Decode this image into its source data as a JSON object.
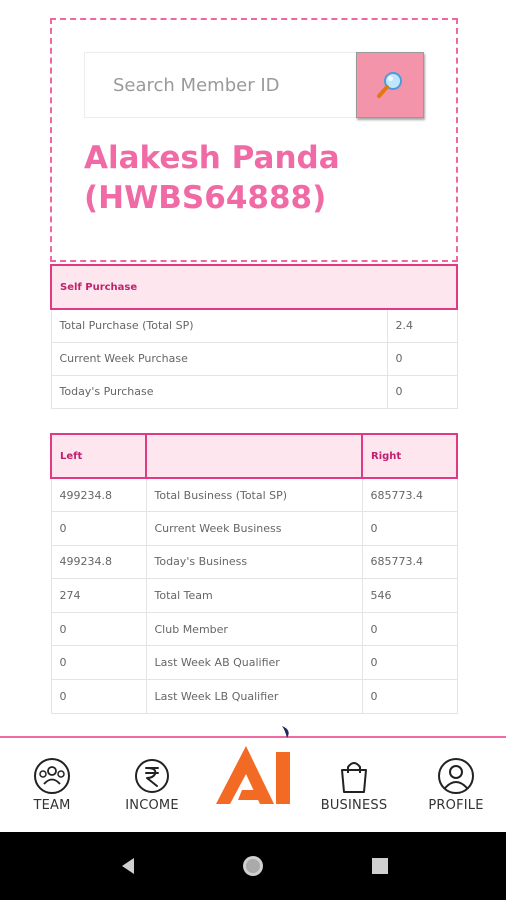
{
  "search": {
    "placeholder": "Search Member ID"
  },
  "member": {
    "name_line1": "Alakesh Panda",
    "name_line2": "(HWBS64888)"
  },
  "self_purchase": {
    "header": "Self Purchase",
    "rows": [
      {
        "label": "Total Purchase (Total SP)",
        "value": "2.4"
      },
      {
        "label": "Current Week Purchase",
        "value": "0"
      },
      {
        "label": "Today's Purchase",
        "value": "0"
      }
    ]
  },
  "binary": {
    "header_left": "Left",
    "header_middle": "",
    "header_right": "Right",
    "rows": [
      {
        "left": "499234.8",
        "label": "Total Business (Total SP)",
        "right": "685773.4"
      },
      {
        "left": "0",
        "label": "Current Week Business",
        "right": "0"
      },
      {
        "left": "499234.8",
        "label": "Today's Business",
        "right": "685773.4"
      },
      {
        "left": "274",
        "label": "Total Team",
        "right": "546"
      },
      {
        "left": "0",
        "label": "Club Member",
        "right": "0"
      },
      {
        "left": "0",
        "label": "Last Week AB Qualifier",
        "right": "0"
      },
      {
        "left": "0",
        "label": "Last Week LB Qualifier",
        "right": "0"
      }
    ]
  },
  "nav": {
    "team": "TEAM",
    "income": "INCOME",
    "business": "BUSINESS",
    "profile": "PROFILE"
  },
  "colors": {
    "accent_pink": "#f06aa6",
    "header_fill": "#fde6ee",
    "logo_orange": "#f26a23",
    "logo_navy": "#1d2a5a"
  },
  "icons": {
    "search": "magnifier-icon",
    "team": "team-icon",
    "income": "rupee-icon",
    "business": "shopping-bag-icon",
    "profile": "user-icon"
  }
}
